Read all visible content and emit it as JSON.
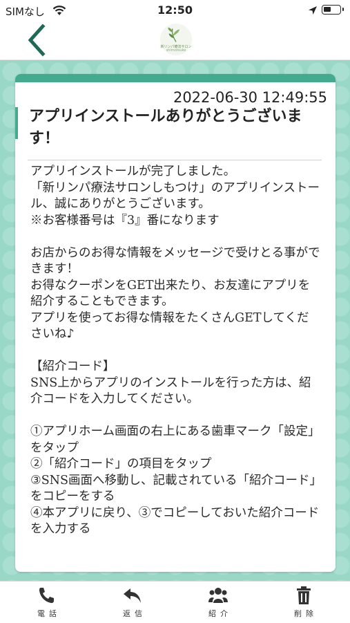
{
  "status_bar": {
    "carrier": "SIMなし",
    "time": "12:50"
  },
  "nav": {
    "logo_text_line1": "新リンパ療法サロン",
    "logo_text_line2": "shimotsuke"
  },
  "message": {
    "date": "2022-06-30 12:49:55",
    "title": "アプリインストールありがとうございます！",
    "body_lines": [
      "アプリインストールが完了しました。",
      "「新リンパ療法サロンしもつけ」のアプリインストール、誠にありがとうございます。",
      "※お客様番号は『3』番になります",
      "",
      "お店からのお得な情報をメッセージで受けとる事ができます！",
      "お得なクーポンをGET出来たり、お友達にアプリを紹介することもできます。",
      "アプリを使ってお得な情報をたくさんGETしてくださいね♪",
      "",
      "【紹介コード】",
      "SNS上からアプリのインストールを行った方は、紹介コードを入力してください。",
      "",
      "①アプリホーム画面の右上にある歯車マーク「設定」をタップ",
      "②「紹介コード」の項目をタップ",
      "③SNS画面へ移動し、記載されている「紹介コード」をコピーをする",
      "④本アプリに戻り、③でコピーしておいた紹介コードを入力する"
    ]
  },
  "tabs": [
    {
      "label": "電話",
      "icon": "phone-icon"
    },
    {
      "label": "返信",
      "icon": "reply-icon"
    },
    {
      "label": "紹介",
      "icon": "users-icon"
    },
    {
      "label": "削除",
      "icon": "trash-icon"
    }
  ],
  "colors": {
    "accent": "#43a98f",
    "background": "#99d7c7"
  }
}
